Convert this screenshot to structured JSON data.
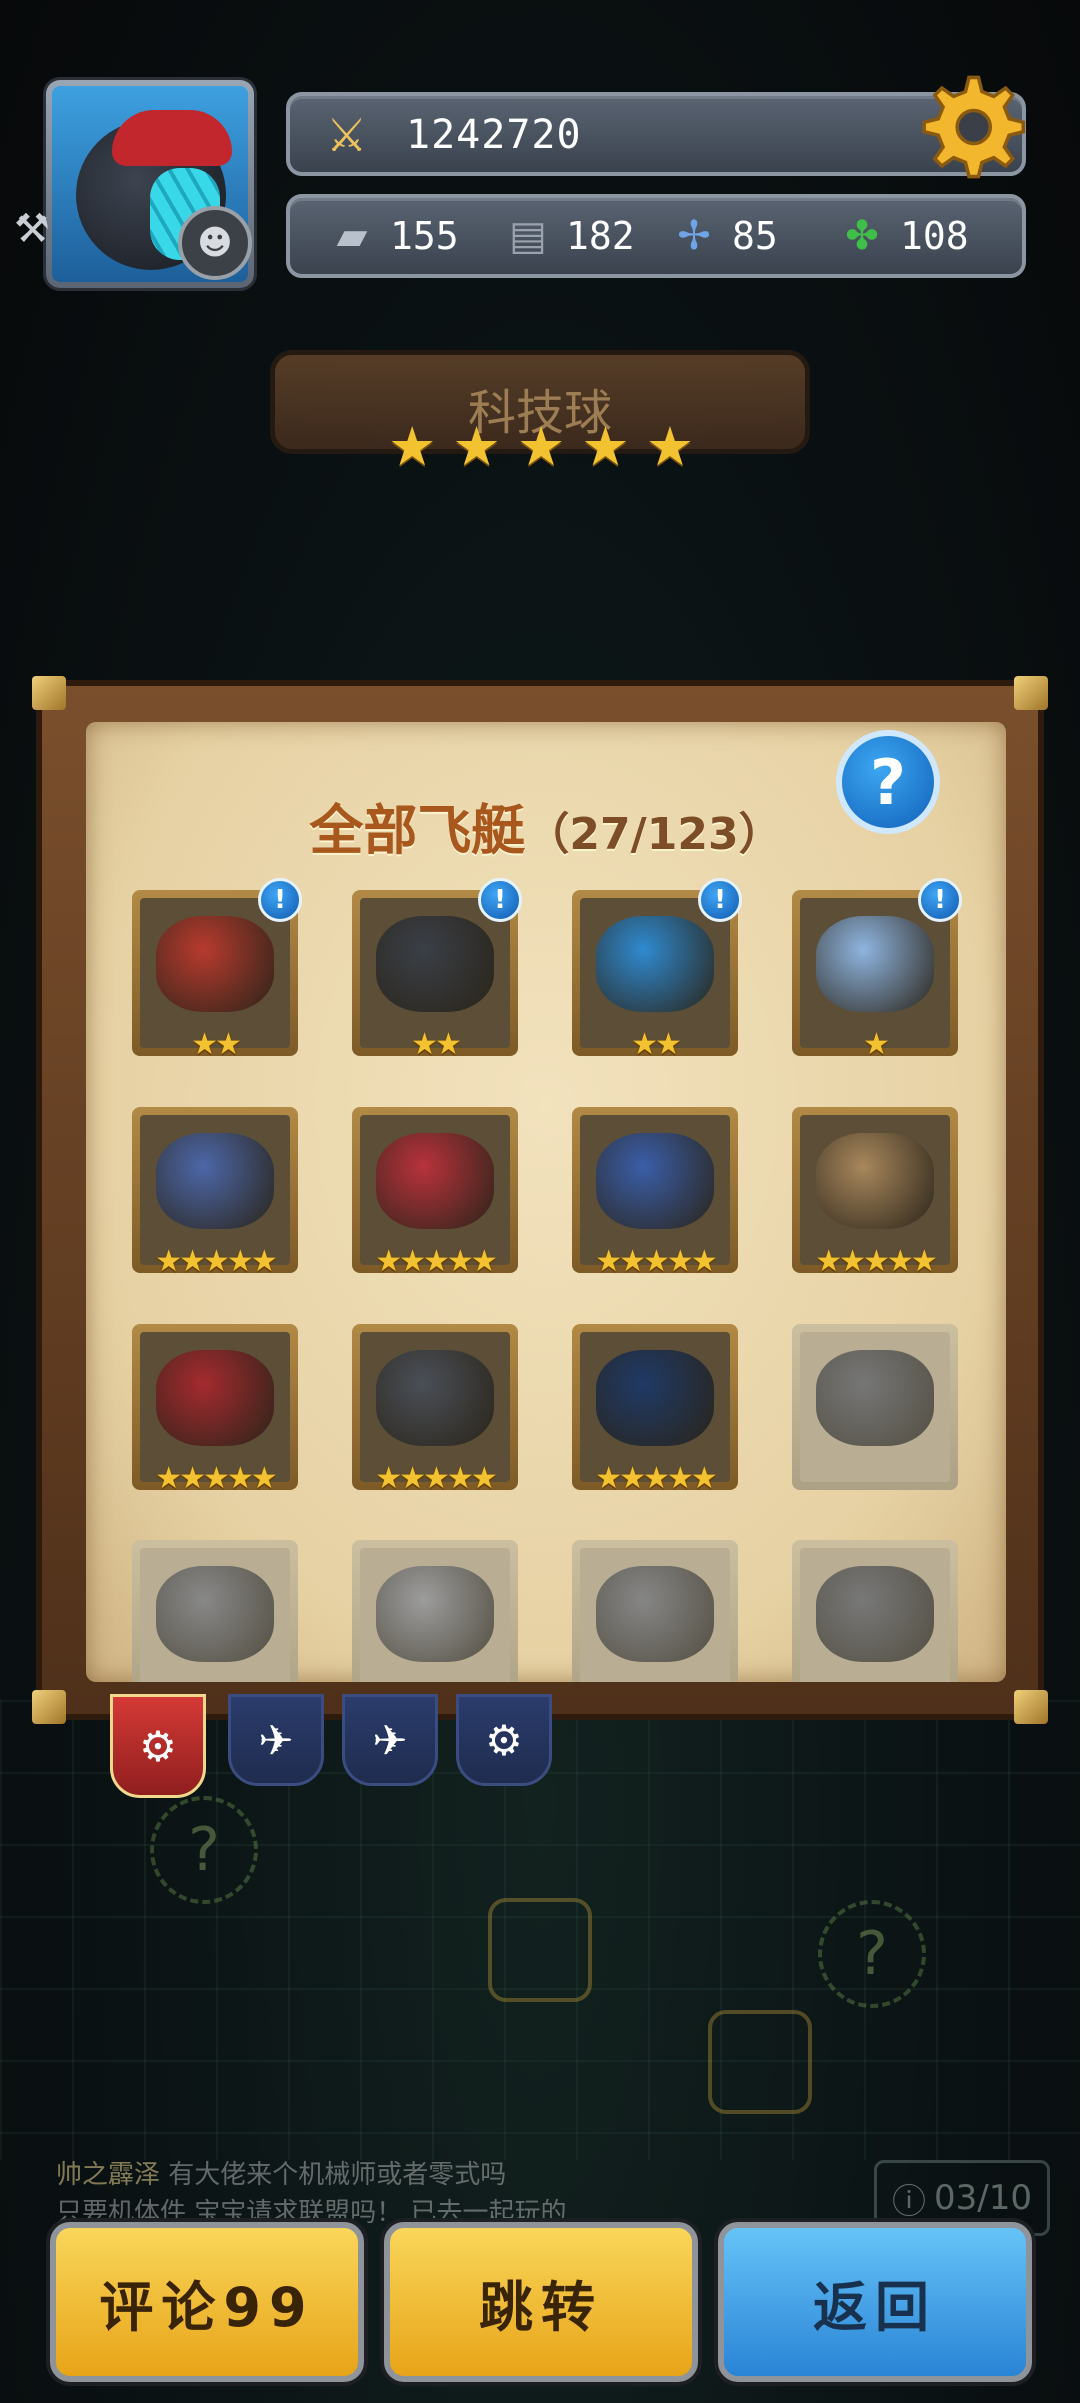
{
  "header": {
    "power": "1242720",
    "resources": [
      {
        "icon": "tank-icon",
        "value": "155"
      },
      {
        "icon": "scroll-icon",
        "value": "182"
      },
      {
        "icon": "fan-icon",
        "value": "85"
      },
      {
        "icon": "clover-icon",
        "value": "108"
      }
    ]
  },
  "title_banner": {
    "name": "科技球",
    "stars": 5
  },
  "panel": {
    "title": "全部飞艇",
    "count": "（27/123）",
    "ships": [
      {
        "stars": "★★",
        "notice": "!",
        "color": "#b83a2e"
      },
      {
        "stars": "★★",
        "notice": "!",
        "color": "#3a3f47"
      },
      {
        "stars": "★★",
        "notice": "!",
        "color": "#2f8ad0"
      },
      {
        "stars": "★",
        "notice": "!",
        "color": "#8fb5e0"
      },
      {
        "stars": "★★★★★",
        "notice": "",
        "color": "#4c67a8"
      },
      {
        "stars": "★★★★★",
        "notice": "",
        "color": "#b8323c"
      },
      {
        "stars": "★★★★★",
        "notice": "",
        "color": "#3a5ea8"
      },
      {
        "stars": "★★★★★",
        "notice": "",
        "color": "#a8875c"
      },
      {
        "stars": "★★★★★",
        "notice": "",
        "color": "#a52a2f"
      },
      {
        "stars": "★★★★★",
        "notice": "",
        "color": "#4a4f57"
      },
      {
        "stars": "★★★★★",
        "notice": "",
        "color": "#1f3a66"
      },
      {
        "stars": "",
        "notice": "",
        "color": "#7d7666"
      },
      {
        "stars": "",
        "notice": "",
        "color": "#8e8878"
      },
      {
        "stars": "",
        "notice": "",
        "color": "#a29c8c"
      },
      {
        "stars": "",
        "notice": "",
        "color": "#8c8676"
      },
      {
        "stars": "",
        "notice": "",
        "color": "#7e786a"
      }
    ]
  },
  "chat": {
    "name": "帅之霹泽",
    "line1": "有大佬来个机械师或者零式吗",
    "line2": "只要机体件 宝宝请求联盟吗！ 已去一起玩的"
  },
  "page_counter": "03/10",
  "buttons": {
    "comment": "评论99",
    "jump": "跳转",
    "back": "返回"
  },
  "colors": {
    "accent_gold": "#f2c230",
    "button_yellow": "#f3c23a",
    "button_blue": "#3a9ee6"
  }
}
